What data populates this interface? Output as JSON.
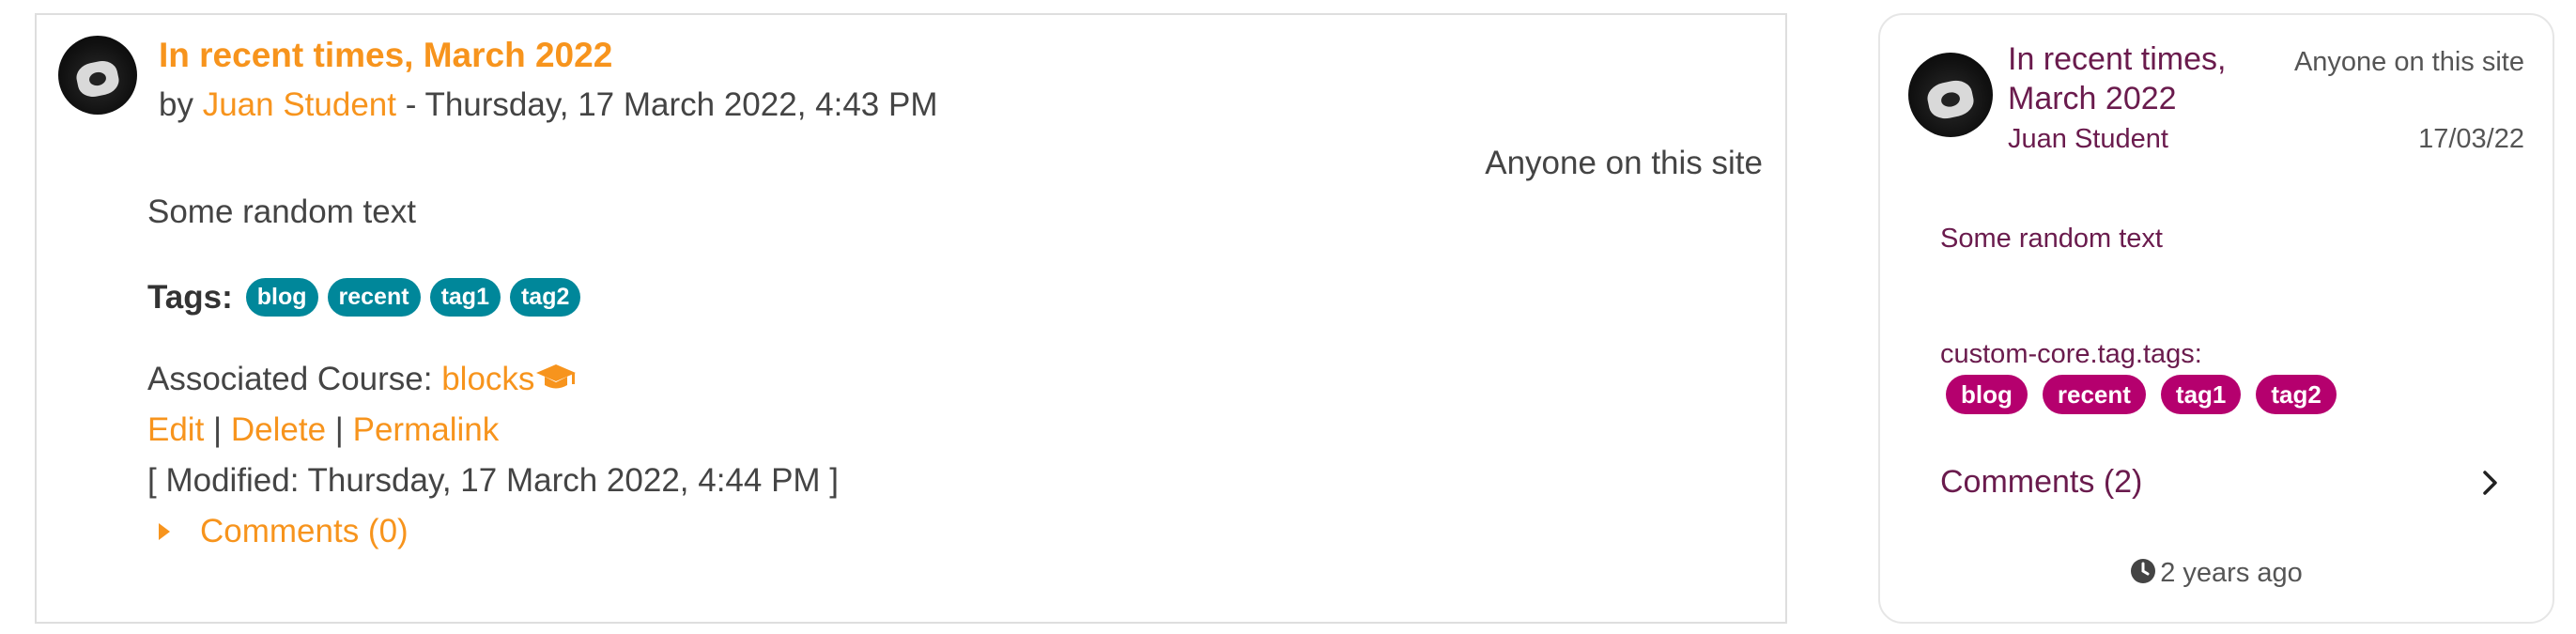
{
  "desktop_entry": {
    "title": "In recent times, March 2022",
    "byline_prefix": "by",
    "author": "Juan Student",
    "datetime": "- Thursday, 17 March 2022, 4:43 PM",
    "visibility": "Anyone on this site",
    "content": "Some random text",
    "tags_label": "Tags:",
    "tags": [
      "blog",
      "recent",
      "tag1",
      "tag2"
    ],
    "course_label": "Associated Course:",
    "course_name": "blocks",
    "course_icon": "graduation-cap-icon",
    "actions": {
      "edit": "Edit",
      "delete": "Delete",
      "permalink": "Permalink",
      "separator": "|"
    },
    "modified": "[ Modified: Thursday, 17 March 2022, 4:44 PM ]",
    "comments": "Comments (0)",
    "accent_color": "#f7941d",
    "tag_color": "#00879a"
  },
  "mobile_card": {
    "title": "In recent times, March 2022",
    "author": "Juan Student",
    "visibility": "Anyone on this site",
    "date": "17/03/22",
    "content": "Some random text",
    "tags_label": "custom-core.tag.tags:",
    "tags": [
      "blog",
      "recent",
      "tag1",
      "tag2"
    ],
    "comments": "Comments (2)",
    "time_ago": "2 years ago",
    "text_color": "#6a1b4d",
    "tag_color": "#b5006e"
  }
}
